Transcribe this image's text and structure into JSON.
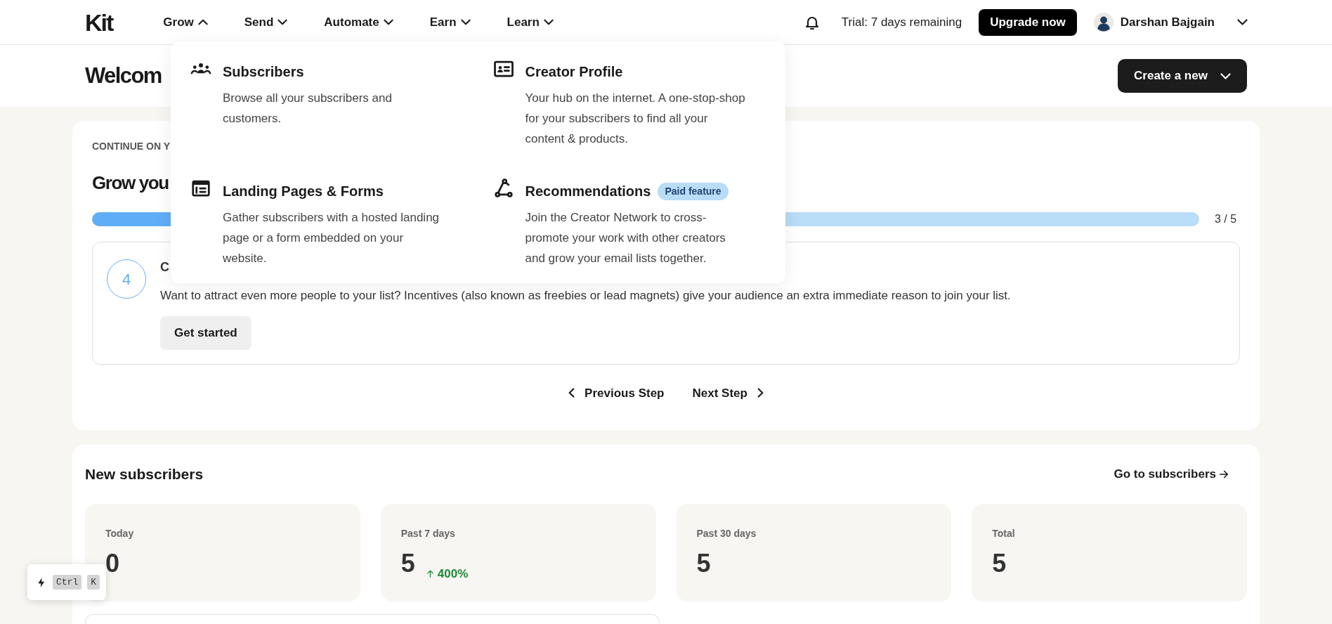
{
  "header": {
    "logo": "Kit",
    "nav": [
      {
        "label": "Grow",
        "expanded": true
      },
      {
        "label": "Send",
        "expanded": false
      },
      {
        "label": "Automate",
        "expanded": false
      },
      {
        "label": "Earn",
        "expanded": false
      },
      {
        "label": "Learn",
        "expanded": false
      }
    ],
    "trial": "Trial: 7 days remaining",
    "upgrade": "Upgrade now",
    "user": "Darshan Bajgain"
  },
  "menu": {
    "items": [
      {
        "title": "Subscribers",
        "description": "Browse all your subscribers and customers."
      },
      {
        "title": "Creator Profile",
        "description": "Your hub on the internet. A one-stop-shop for your subscribers to find all your content & products."
      },
      {
        "title": "Landing Pages & Forms",
        "description": "Gather subscribers with a hosted landing page or a form embedded on your website."
      },
      {
        "title": "Recommendations",
        "badge": "Paid feature",
        "description": "Join the Creator Network to cross-promote your work with other creators and grow your email lists together."
      }
    ]
  },
  "welcome": {
    "title": "Welcom",
    "create_button": "Create a new"
  },
  "onboarding": {
    "eyebrow": "CONTINUE ON Y",
    "title": "Grow you",
    "progress": {
      "level": 0.6
    },
    "progress_label": "3 / 5",
    "step": {
      "number": "4",
      "title": "C",
      "description": "Want to attract even more people to your list? Incentives (also known as freebies or lead magnets) give your audience an extra immediate reason to join your list.",
      "button": "Get started"
    },
    "previous": "Previous Step",
    "next": "Next Step"
  },
  "subscribers": {
    "title": "New subscribers",
    "link": "Go to subscribers",
    "stats": [
      {
        "label": "Today",
        "value": "0"
      },
      {
        "label": "Past 7 days",
        "value": "5",
        "change": "400%"
      },
      {
        "label": "Past 30 days",
        "value": "5"
      },
      {
        "label": "Total",
        "value": "5"
      }
    ]
  },
  "shortcut": {
    "keys": [
      "Ctrl",
      "K"
    ]
  }
}
